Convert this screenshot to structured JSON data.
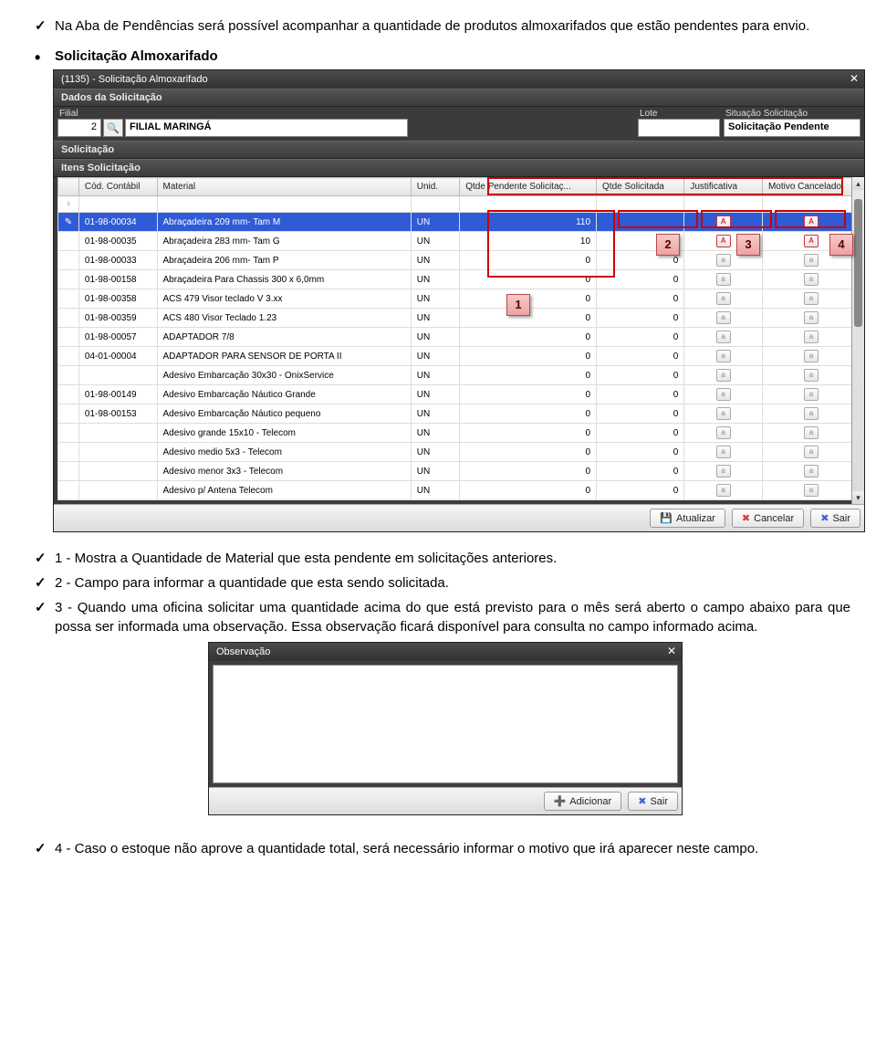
{
  "intro_text": "Na Aba de Pendências será possível acompanhar a quantidade de produtos almoxarifados que estão pendentes para envio.",
  "section_heading": "Solicitação Almoxarifado",
  "win1": {
    "title": "(1135) - Solicitação Almoxarifado",
    "labels": {
      "dados": "Dados da Solicitação",
      "filial": "Filial",
      "lote": "Lote",
      "situacao": "Situação Solicitação",
      "solicitacao": "Solicitação",
      "itens": "Itens Solicitação"
    },
    "filial_id": "2",
    "filial_name": "FILIAL MARINGÁ",
    "lote_val": "",
    "situ_val": "Solicitação Pendente",
    "headers": {
      "cod": "Cód. Contábil",
      "material": "Material",
      "unid": "Unid.",
      "qtdepend": "Qtde Pendente Solicitaç...",
      "qtdesol": "Qtde Solicitada",
      "justif": "Justificativa",
      "motivo": "Motivo Cancelado"
    },
    "rows": [
      {
        "cod": "01-98-00034",
        "mat": "Abraçadeira 209 mm- Tam M",
        "un": "UN",
        "qp": "110",
        "qs": "",
        "sel": true
      },
      {
        "cod": "01-98-00035",
        "mat": "Abraçadeira 283 mm- Tam G",
        "un": "UN",
        "qp": "10",
        "qs": "0"
      },
      {
        "cod": "01-98-00033",
        "mat": "Abraçadeira 206 mm- Tam P",
        "un": "UN",
        "qp": "0",
        "qs": "0"
      },
      {
        "cod": "01-98-00158",
        "mat": "Abraçadeira Para Chassis  300 x 6,0mm",
        "un": "UN",
        "qp": "0",
        "qs": "0"
      },
      {
        "cod": "01-98-00358",
        "mat": "ACS 479 Visor teclado V 3.xx",
        "un": "UN",
        "qp": "0",
        "qs": "0"
      },
      {
        "cod": "01-98-00359",
        "mat": "ACS 480  Visor Teclado 1.23",
        "un": "UN",
        "qp": "0",
        "qs": "0"
      },
      {
        "cod": "01-98-00057",
        "mat": "ADAPTADOR 7/8",
        "un": "UN",
        "qp": "0",
        "qs": "0"
      },
      {
        "cod": "04-01-00004",
        "mat": "ADAPTADOR PARA SENSOR DE PORTA II",
        "un": "UN",
        "qp": "0",
        "qs": "0"
      },
      {
        "cod": "",
        "mat": "Adesivo Embarcação 30x30 - OnixService",
        "un": "UN",
        "qp": "0",
        "qs": "0"
      },
      {
        "cod": "01-98-00149",
        "mat": "Adesivo Embarcação Náutico Grande",
        "un": "UN",
        "qp": "0",
        "qs": "0"
      },
      {
        "cod": "01-98-00153",
        "mat": "Adesivo Embarcação Náutico pequeno",
        "un": "UN",
        "qp": "0",
        "qs": "0"
      },
      {
        "cod": "",
        "mat": "Adesivo grande 15x10 - Telecom",
        "un": "UN",
        "qp": "0",
        "qs": "0"
      },
      {
        "cod": "",
        "mat": "Adesivo medio 5x3 - Telecom",
        "un": "UN",
        "qp": "0",
        "qs": "0"
      },
      {
        "cod": "",
        "mat": "Adesivo menor 3x3 - Telecom",
        "un": "UN",
        "qp": "0",
        "qs": "0"
      },
      {
        "cod": "",
        "mat": "Adesivo p/ Antena Telecom",
        "un": "UN",
        "qp": "0",
        "qs": "0"
      }
    ],
    "buttons": {
      "atualizar": "Atualizar",
      "cancelar": "Cancelar",
      "sair": "Sair"
    },
    "callouts": {
      "c1": "1",
      "c2": "2",
      "c3": "3",
      "c4": "4"
    }
  },
  "notes": {
    "n1": "1 - Mostra a Quantidade de Material que esta pendente em solicitações anteriores.",
    "n2": "2 - Campo para informar a quantidade que esta sendo solicitada.",
    "n3": "3 - Quando uma oficina solicitar uma quantidade acima do que está previsto para o mês será aberto o campo abaixo para que possa ser informada uma observação. Essa observação ficará disponível para consulta no campo informado acima."
  },
  "win2": {
    "title": "Observação",
    "buttons": {
      "adicionar": "Adicionar",
      "sair": "Sair"
    }
  },
  "note4": "4 - Caso o estoque não aprove a quantidade total, será necessário informar o motivo que irá aparecer neste campo."
}
